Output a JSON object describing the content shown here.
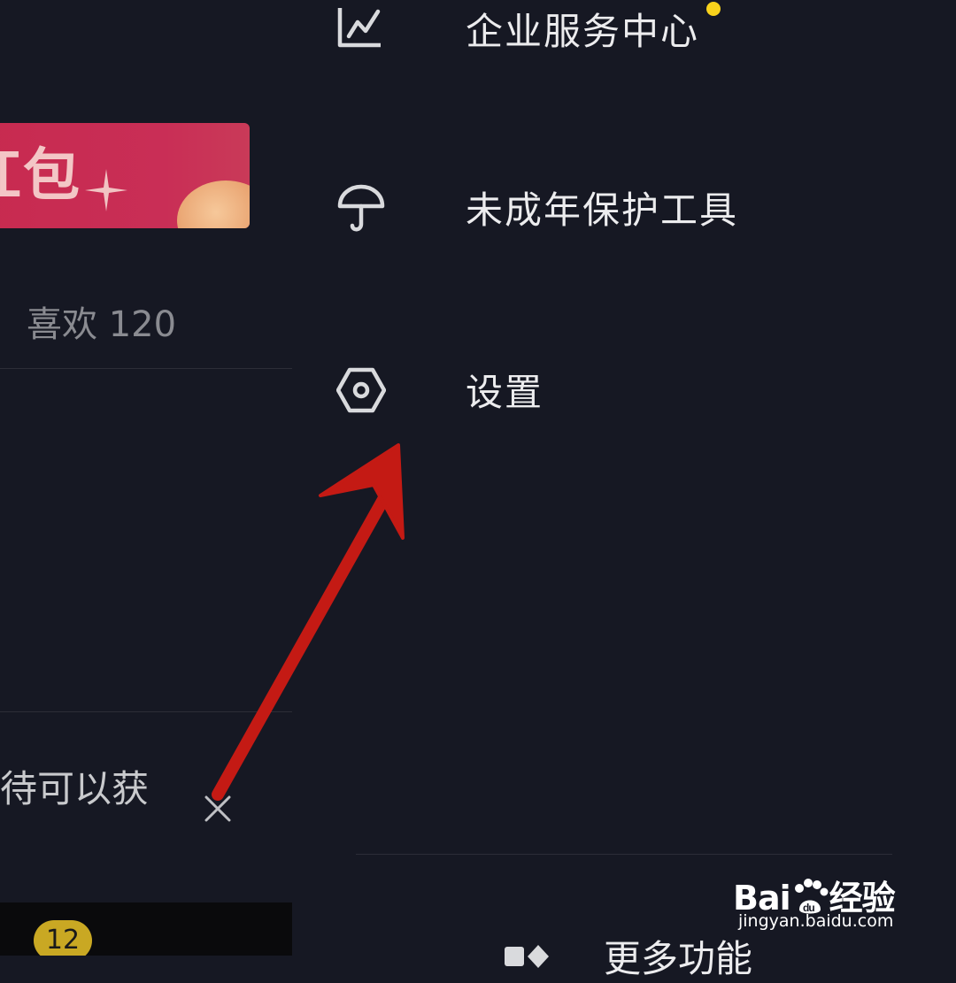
{
  "left_panel": {
    "banner_text": "红包",
    "likes_label": "喜欢 120",
    "promo_text": "待可以获",
    "badge_count": "12"
  },
  "drawer": {
    "items": [
      {
        "label": "企业服务中心",
        "icon": "chart-line-icon",
        "has_dot": true
      },
      {
        "label": "未成年保护工具",
        "icon": "umbrella-icon"
      },
      {
        "label": "设置",
        "icon": "hexagon-settings-icon"
      }
    ],
    "more_label": "更多功能"
  },
  "watermark": {
    "brand_left": "Bai",
    "brand_right": "经验",
    "url": "jingyan.baidu.com"
  },
  "colors": {
    "background": "#161823",
    "banner": "#c92e56",
    "dot": "#f8d21c",
    "badge": "#c9a823",
    "arrow": "#c41a14"
  }
}
